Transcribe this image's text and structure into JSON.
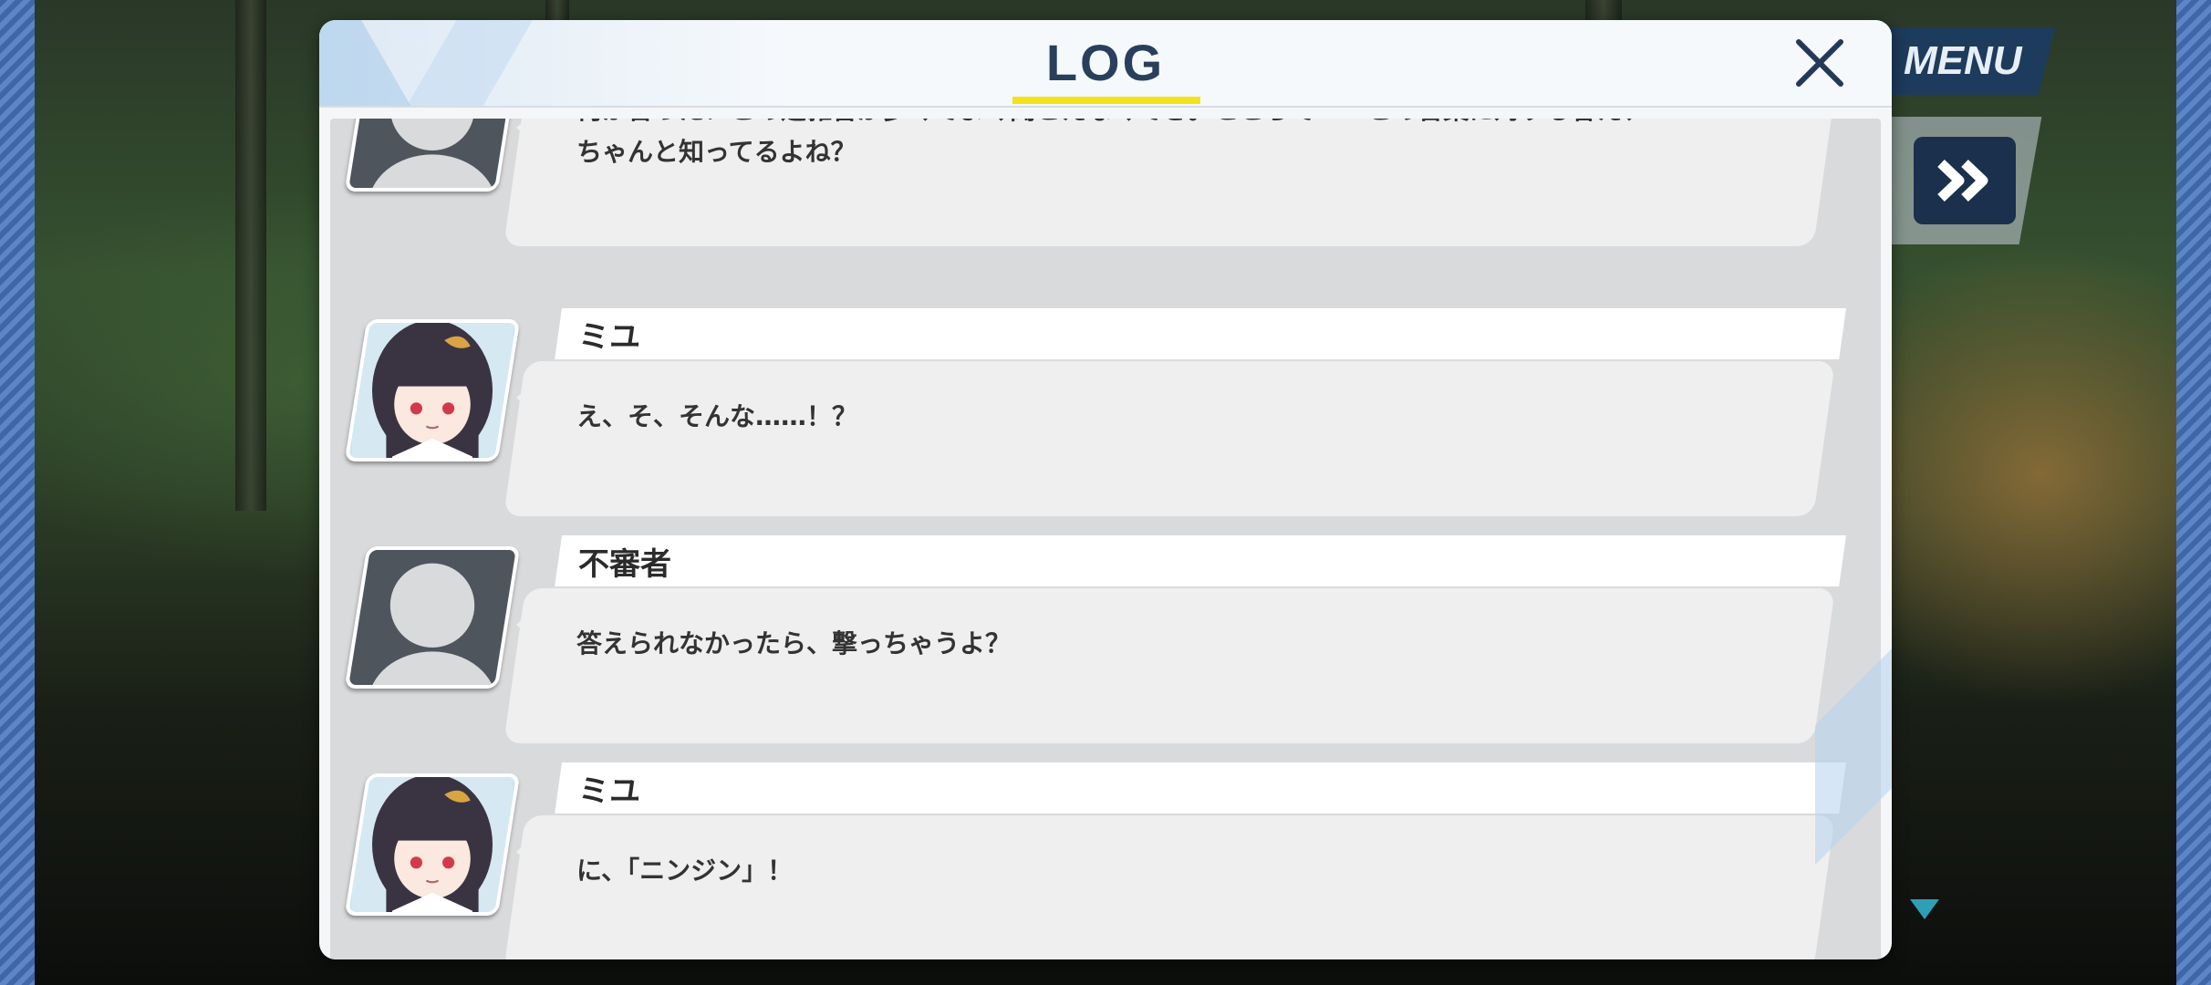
{
  "hud": {
    "menu_label": "MENU",
    "fast_forward_icon": "double-chevron-right-icon"
  },
  "log": {
    "title": "LOG",
    "close_icon": "close-icon",
    "accent_color": "#f4e21a",
    "entries": [
      {
        "speaker": "",
        "portrait": "silhouette",
        "text_line1": "何か言った？この辺雑音が多くてよく聞こえなくてさ。ところで……この言葉に対する答え、",
        "text_line2": "ちゃんと知ってるよね？"
      },
      {
        "speaker": "ミユ",
        "portrait": "miyu",
        "text_line1": "え、そ、そんな……！？",
        "text_line2": ""
      },
      {
        "speaker": "不審者",
        "portrait": "silhouette",
        "text_line1": "答えられなかったら、撃っちゃうよ？",
        "text_line2": ""
      },
      {
        "speaker": "ミユ",
        "portrait": "miyu",
        "text_line1": "に、「ニンジン」！",
        "text_line2": ""
      }
    ]
  }
}
